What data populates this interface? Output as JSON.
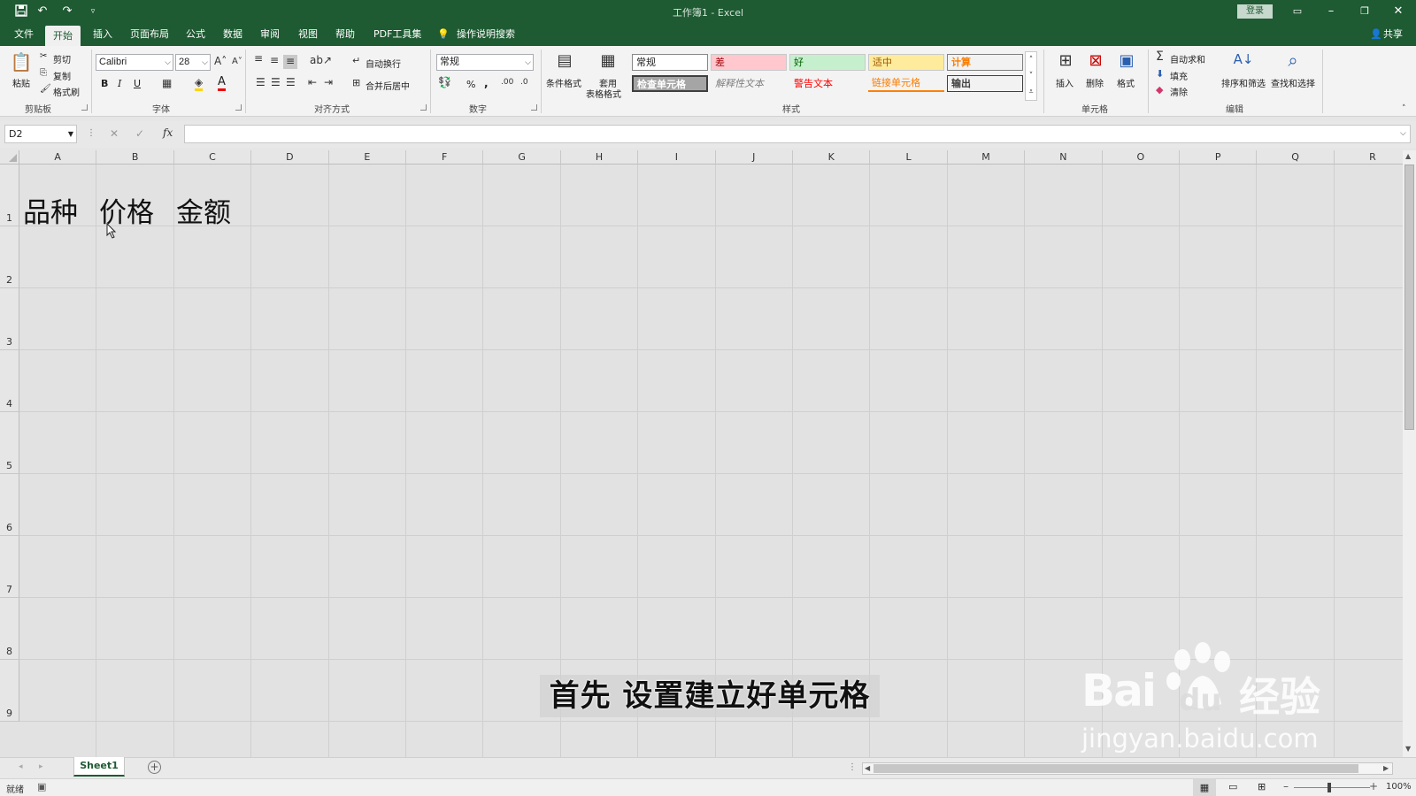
{
  "titlebar": {
    "title": "工作簿1  -  Excel",
    "login_label": "登录"
  },
  "menu": {
    "items": [
      "文件",
      "开始",
      "插入",
      "页面布局",
      "公式",
      "数据",
      "审阅",
      "视图",
      "帮助",
      "PDF工具集"
    ],
    "search": "操作说明搜索",
    "share": "共享"
  },
  "ribbon": {
    "clipboard": {
      "paste": "粘贴",
      "cut": "剪切",
      "copy": "复制",
      "format_painter": "格式刷",
      "label": "剪贴板"
    },
    "font": {
      "name": "Calibri",
      "size": "28",
      "label": "字体",
      "bold": "B",
      "italic": "I",
      "underline": "U"
    },
    "alignment": {
      "wrap": "自动换行",
      "merge": "合并后居中",
      "label": "对齐方式"
    },
    "number": {
      "format": "常规",
      "percent": "%",
      "comma": ",",
      "label": "数字"
    },
    "styles": {
      "cond_format": "条件格式",
      "table_format_1": "套用",
      "table_format_2": "表格格式",
      "cells": [
        "常规",
        "差",
        "好",
        "适中",
        "计算",
        "检查单元格",
        "解释性文本",
        "警告文本",
        "链接单元格",
        "输出"
      ],
      "label": "样式"
    },
    "cells_group": {
      "insert": "插入",
      "delete": "删除",
      "format": "格式",
      "label": "单元格"
    },
    "editing": {
      "autosum": "自动求和",
      "fill": "填充",
      "clear": "清除",
      "sort": "排序和筛选",
      "find": "查找和选择",
      "label": "编辑"
    }
  },
  "formula_bar": {
    "name_box": "D2",
    "fx": "fx",
    "value": ""
  },
  "grid": {
    "columns": [
      "A",
      "B",
      "C",
      "D",
      "E",
      "F",
      "G",
      "H",
      "I",
      "J",
      "K",
      "L",
      "M",
      "N",
      "O",
      "P",
      "Q",
      "R"
    ],
    "rows": [
      "1",
      "2",
      "3",
      "4",
      "5",
      "6",
      "7",
      "8",
      "9"
    ],
    "cells": {
      "A1": "品种",
      "B1": "价格",
      "C1": "金额"
    }
  },
  "sheet_tabs": {
    "active": "Sheet1"
  },
  "status": {
    "ready": "就绪",
    "zoom": "100%"
  },
  "overlay": {
    "subtitle": "首先 设置建立好单元格",
    "watermark_brand": "Bai",
    "watermark_brand2": "du",
    "watermark_cn": "经验",
    "watermark_url": "jingyan.baidu.com"
  },
  "colors": {
    "excel_green": "#1e5a32",
    "bad": "#ffc7ce",
    "good": "#c6efce",
    "neutral": "#ffeb9c",
    "calc": "#f2f2f2"
  }
}
